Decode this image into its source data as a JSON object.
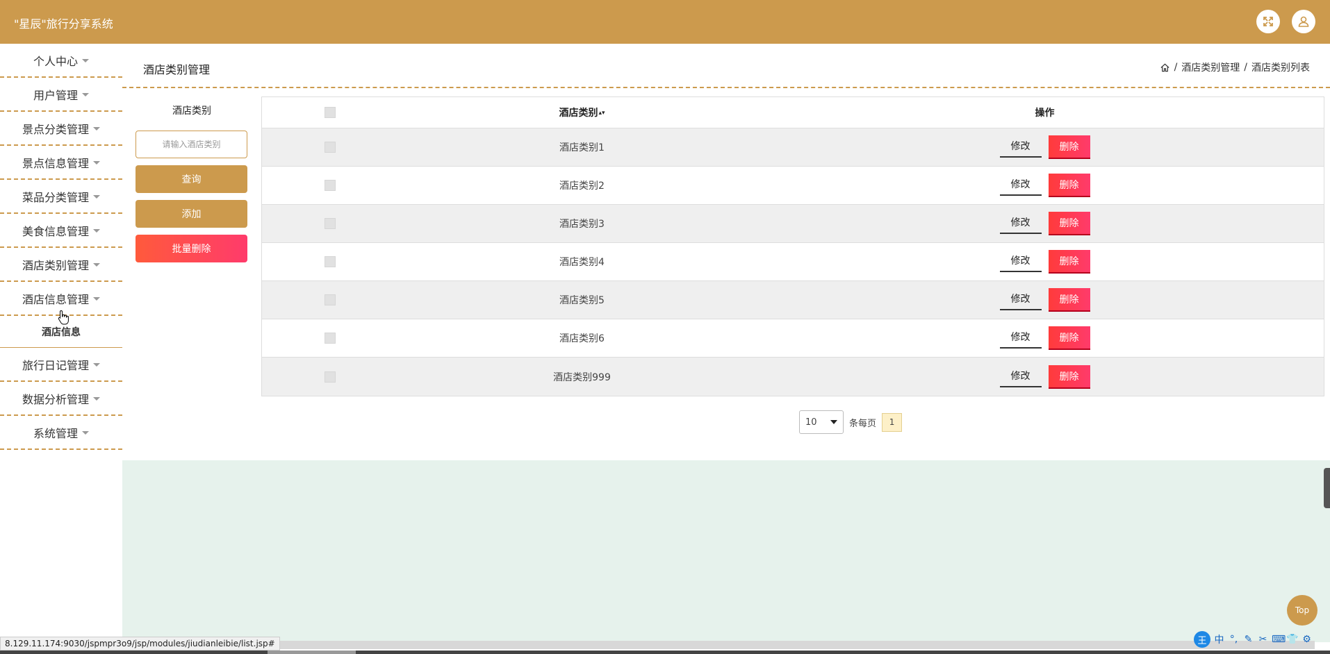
{
  "header": {
    "title": "\"星辰\"旅行分享系统",
    "icons": [
      "fullscreen-icon",
      "user-icon"
    ]
  },
  "sidebar": {
    "items": [
      {
        "label": "个人中心"
      },
      {
        "label": "用户管理"
      },
      {
        "label": "景点分类管理"
      },
      {
        "label": "景点信息管理"
      },
      {
        "label": "菜品分类管理"
      },
      {
        "label": "美食信息管理"
      },
      {
        "label": "酒店类别管理"
      },
      {
        "label": "酒店信息管理"
      },
      {
        "label": "旅行日记管理"
      },
      {
        "label": "数据分析管理"
      },
      {
        "label": "系统管理"
      }
    ],
    "submenu": {
      "label": "酒店信息"
    }
  },
  "page": {
    "title": "酒店类别管理",
    "breadcrumb": [
      "酒店类别管理",
      "酒店类别列表"
    ],
    "separator": "/"
  },
  "filter": {
    "label": "酒店类别",
    "placeholder": "请输入酒店类别",
    "query_button": "查询",
    "add_button": "添加",
    "batch_delete_button": "批量删除"
  },
  "table": {
    "columns": [
      "酒店类别",
      "操作"
    ],
    "sort_glyph": "▴▾",
    "edit_label": "修改",
    "delete_label": "删除",
    "rows": [
      {
        "name": "酒店类别1"
      },
      {
        "name": "酒店类别2"
      },
      {
        "name": "酒店类别3"
      },
      {
        "name": "酒店类别4"
      },
      {
        "name": "酒店类别5"
      },
      {
        "name": "酒店类别6"
      },
      {
        "name": "酒店类别999"
      }
    ]
  },
  "pagination": {
    "page_size": "10",
    "per_page_label": "条每页",
    "current_page": "1"
  },
  "top_button": "Top",
  "status_url": "8.129.11.174:9030/jspmpr3o9/jsp/modules/jiudianleibie/list.jsp#",
  "ime": {
    "logo": "王",
    "chars": [
      "中",
      "°,",
      "✎",
      "✂",
      "⌨",
      "👕",
      "⚙"
    ]
  },
  "colors": {
    "accent": "#cc9a4d",
    "danger": "#ff3b3b",
    "content_bg": "#e6f2ec"
  }
}
